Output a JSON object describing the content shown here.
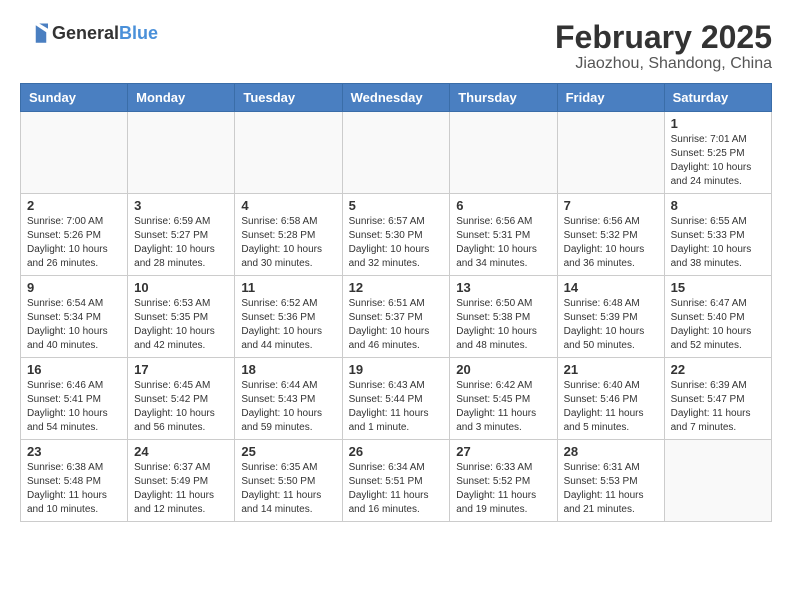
{
  "header": {
    "logo_general": "General",
    "logo_blue": "Blue",
    "title": "February 2025",
    "subtitle": "Jiaozhou, Shandong, China"
  },
  "weekdays": [
    "Sunday",
    "Monday",
    "Tuesday",
    "Wednesday",
    "Thursday",
    "Friday",
    "Saturday"
  ],
  "weeks": [
    [
      {
        "day": "",
        "info": ""
      },
      {
        "day": "",
        "info": ""
      },
      {
        "day": "",
        "info": ""
      },
      {
        "day": "",
        "info": ""
      },
      {
        "day": "",
        "info": ""
      },
      {
        "day": "",
        "info": ""
      },
      {
        "day": "1",
        "info": "Sunrise: 7:01 AM\nSunset: 5:25 PM\nDaylight: 10 hours and 24 minutes."
      }
    ],
    [
      {
        "day": "2",
        "info": "Sunrise: 7:00 AM\nSunset: 5:26 PM\nDaylight: 10 hours and 26 minutes."
      },
      {
        "day": "3",
        "info": "Sunrise: 6:59 AM\nSunset: 5:27 PM\nDaylight: 10 hours and 28 minutes."
      },
      {
        "day": "4",
        "info": "Sunrise: 6:58 AM\nSunset: 5:28 PM\nDaylight: 10 hours and 30 minutes."
      },
      {
        "day": "5",
        "info": "Sunrise: 6:57 AM\nSunset: 5:30 PM\nDaylight: 10 hours and 32 minutes."
      },
      {
        "day": "6",
        "info": "Sunrise: 6:56 AM\nSunset: 5:31 PM\nDaylight: 10 hours and 34 minutes."
      },
      {
        "day": "7",
        "info": "Sunrise: 6:56 AM\nSunset: 5:32 PM\nDaylight: 10 hours and 36 minutes."
      },
      {
        "day": "8",
        "info": "Sunrise: 6:55 AM\nSunset: 5:33 PM\nDaylight: 10 hours and 38 minutes."
      }
    ],
    [
      {
        "day": "9",
        "info": "Sunrise: 6:54 AM\nSunset: 5:34 PM\nDaylight: 10 hours and 40 minutes."
      },
      {
        "day": "10",
        "info": "Sunrise: 6:53 AM\nSunset: 5:35 PM\nDaylight: 10 hours and 42 minutes."
      },
      {
        "day": "11",
        "info": "Sunrise: 6:52 AM\nSunset: 5:36 PM\nDaylight: 10 hours and 44 minutes."
      },
      {
        "day": "12",
        "info": "Sunrise: 6:51 AM\nSunset: 5:37 PM\nDaylight: 10 hours and 46 minutes."
      },
      {
        "day": "13",
        "info": "Sunrise: 6:50 AM\nSunset: 5:38 PM\nDaylight: 10 hours and 48 minutes."
      },
      {
        "day": "14",
        "info": "Sunrise: 6:48 AM\nSunset: 5:39 PM\nDaylight: 10 hours and 50 minutes."
      },
      {
        "day": "15",
        "info": "Sunrise: 6:47 AM\nSunset: 5:40 PM\nDaylight: 10 hours and 52 minutes."
      }
    ],
    [
      {
        "day": "16",
        "info": "Sunrise: 6:46 AM\nSunset: 5:41 PM\nDaylight: 10 hours and 54 minutes."
      },
      {
        "day": "17",
        "info": "Sunrise: 6:45 AM\nSunset: 5:42 PM\nDaylight: 10 hours and 56 minutes."
      },
      {
        "day": "18",
        "info": "Sunrise: 6:44 AM\nSunset: 5:43 PM\nDaylight: 10 hours and 59 minutes."
      },
      {
        "day": "19",
        "info": "Sunrise: 6:43 AM\nSunset: 5:44 PM\nDaylight: 11 hours and 1 minute."
      },
      {
        "day": "20",
        "info": "Sunrise: 6:42 AM\nSunset: 5:45 PM\nDaylight: 11 hours and 3 minutes."
      },
      {
        "day": "21",
        "info": "Sunrise: 6:40 AM\nSunset: 5:46 PM\nDaylight: 11 hours and 5 minutes."
      },
      {
        "day": "22",
        "info": "Sunrise: 6:39 AM\nSunset: 5:47 PM\nDaylight: 11 hours and 7 minutes."
      }
    ],
    [
      {
        "day": "23",
        "info": "Sunrise: 6:38 AM\nSunset: 5:48 PM\nDaylight: 11 hours and 10 minutes."
      },
      {
        "day": "24",
        "info": "Sunrise: 6:37 AM\nSunset: 5:49 PM\nDaylight: 11 hours and 12 minutes."
      },
      {
        "day": "25",
        "info": "Sunrise: 6:35 AM\nSunset: 5:50 PM\nDaylight: 11 hours and 14 minutes."
      },
      {
        "day": "26",
        "info": "Sunrise: 6:34 AM\nSunset: 5:51 PM\nDaylight: 11 hours and 16 minutes."
      },
      {
        "day": "27",
        "info": "Sunrise: 6:33 AM\nSunset: 5:52 PM\nDaylight: 11 hours and 19 minutes."
      },
      {
        "day": "28",
        "info": "Sunrise: 6:31 AM\nSunset: 5:53 PM\nDaylight: 11 hours and 21 minutes."
      },
      {
        "day": "",
        "info": ""
      }
    ]
  ]
}
